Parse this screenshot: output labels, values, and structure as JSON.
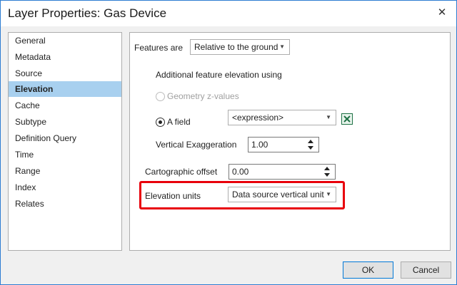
{
  "window": {
    "title": "Layer Properties: Gas Device"
  },
  "sidebar": {
    "items": [
      {
        "label": "General"
      },
      {
        "label": "Metadata"
      },
      {
        "label": "Source"
      },
      {
        "label": "Elevation",
        "active": true
      },
      {
        "label": "Cache"
      },
      {
        "label": "Subtype"
      },
      {
        "label": "Definition Query"
      },
      {
        "label": "Time"
      },
      {
        "label": "Range"
      },
      {
        "label": "Index"
      },
      {
        "label": "Relates"
      }
    ]
  },
  "elevation": {
    "features_are_label": "Features are",
    "features_are_value": "Relative to the ground",
    "additional_label": "Additional feature elevation using",
    "geometry_option": "Geometry z-values",
    "field_option": "A field",
    "field_value": "<expression>",
    "vertical_exag_label": "Vertical Exaggeration",
    "vertical_exag_value": "1.00",
    "carto_offset_label": "Cartographic offset",
    "carto_offset_value": "0.00",
    "elev_units_label": "Elevation units",
    "elev_units_value": "Data source vertical unit"
  },
  "footer": {
    "ok_label": "OK",
    "cancel_label": "Cancel"
  },
  "colors": {
    "highlight": "#e8000b",
    "selection": "#a8d0ef",
    "accent": "#0078d7"
  }
}
